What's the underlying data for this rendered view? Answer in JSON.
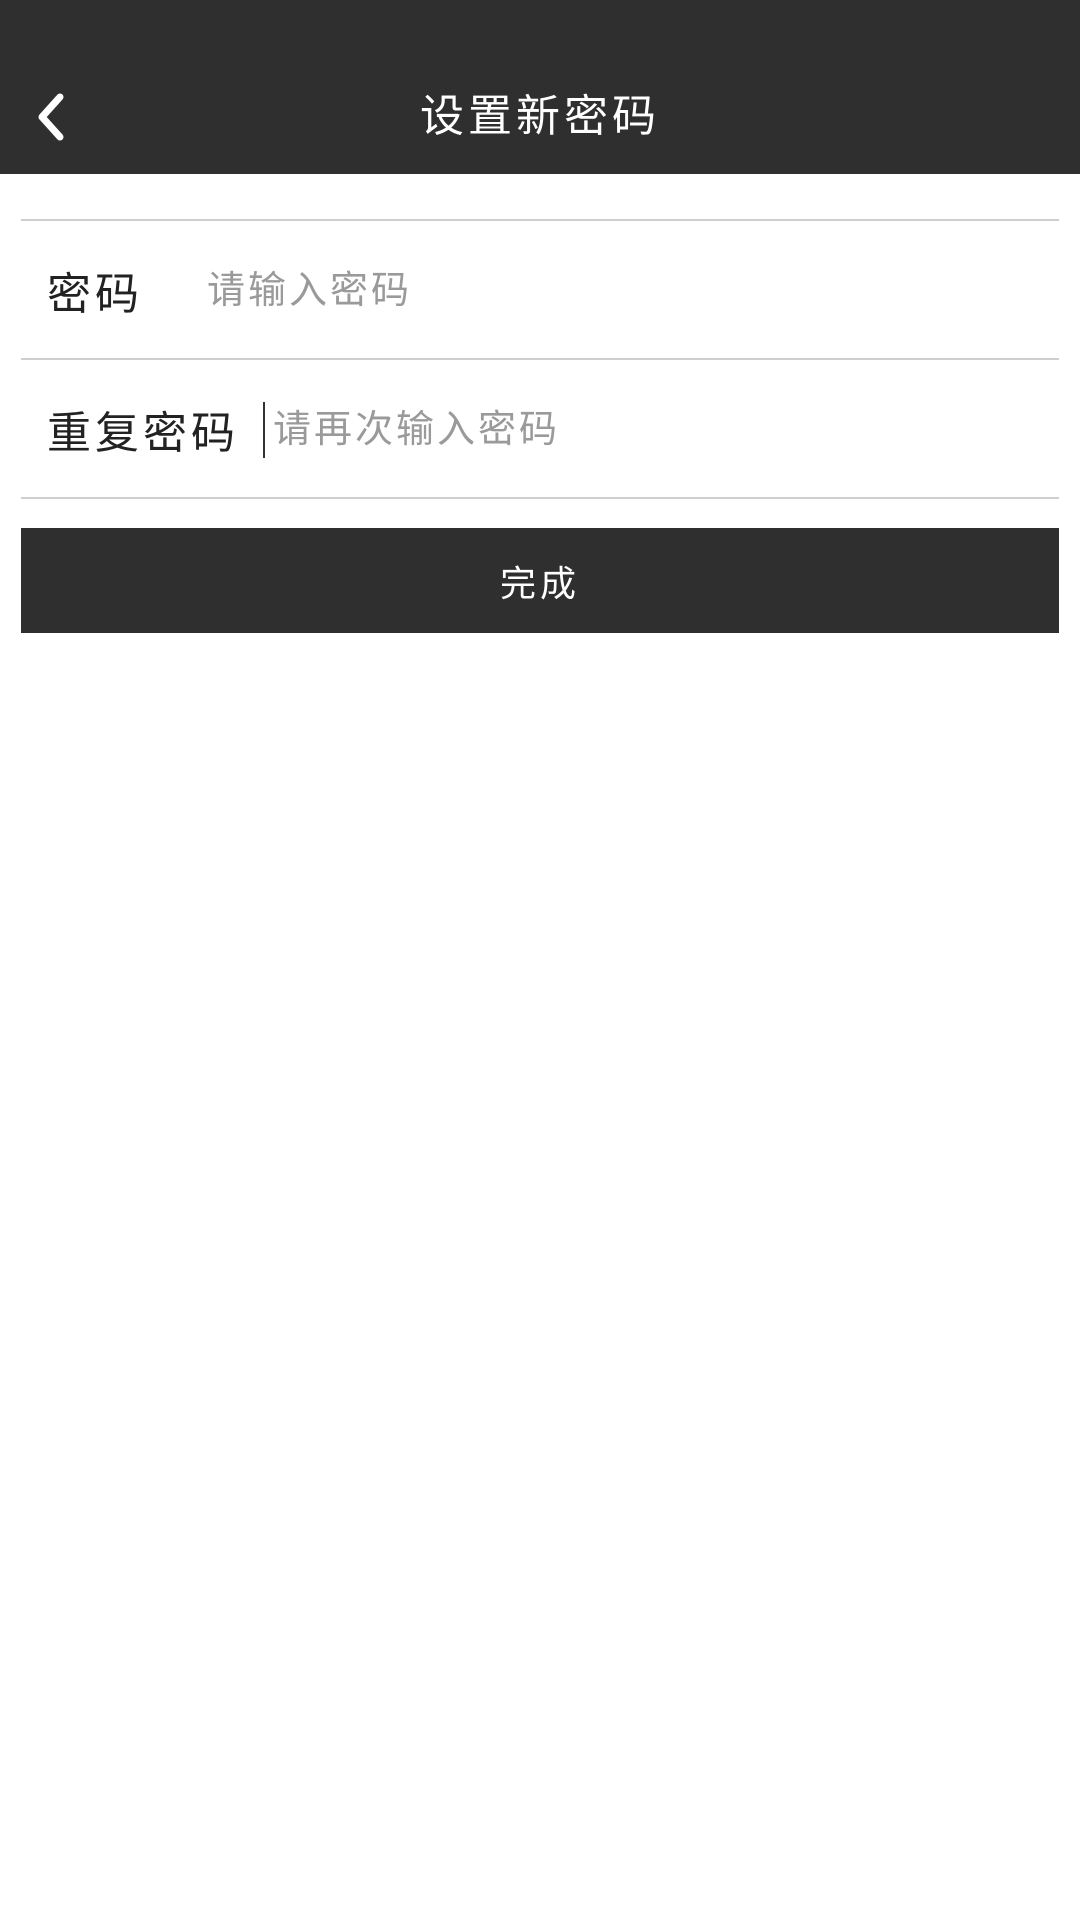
{
  "header": {
    "title": "设置新密码",
    "back_icon": "chevron-left-icon"
  },
  "form": {
    "password": {
      "label": "密码",
      "placeholder": "请输入密码",
      "value": ""
    },
    "repeat_password": {
      "label": "重复密码",
      "placeholder": "请再次输入密码",
      "value": ""
    },
    "submit_label": "完成"
  },
  "colors": {
    "bar_background": "#2f2f2f",
    "divider": "#cfcfcf",
    "placeholder": "#9a9a9a"
  }
}
